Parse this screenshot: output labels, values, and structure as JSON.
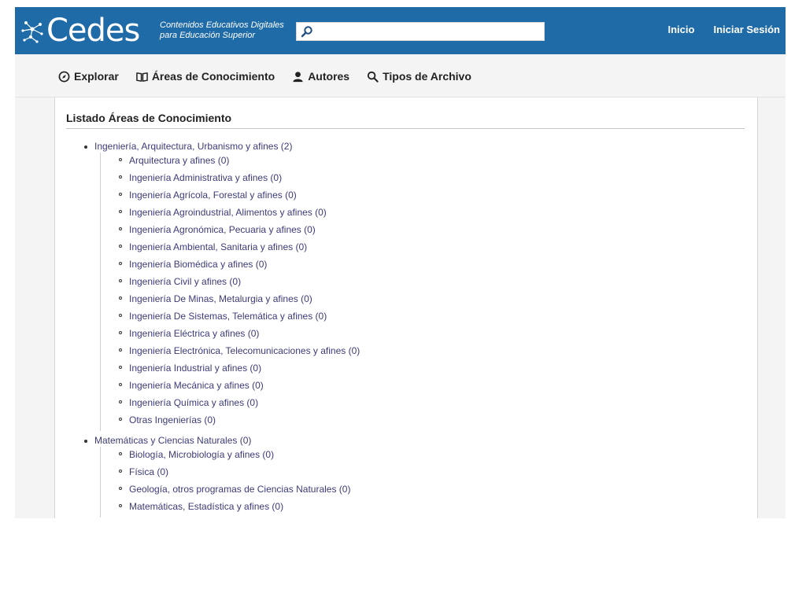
{
  "header": {
    "logo_text": "Cedes",
    "tagline_line1": "Contenidos Educativos Digitales",
    "tagline_line2": "para Educación Superior",
    "search": {
      "placeholder": "",
      "value": ""
    },
    "links": [
      "Inicio",
      "Iniciar Sesión"
    ],
    "colors": {
      "bar": "#1f6ba8"
    }
  },
  "nav": {
    "items": [
      {
        "label": "Explorar",
        "icon": "compass-icon"
      },
      {
        "label": "Áreas de Conocimiento",
        "icon": "book-icon"
      },
      {
        "label": "Autores",
        "icon": "user-icon"
      },
      {
        "label": "Tipos de Archivo",
        "icon": "search-icon"
      }
    ]
  },
  "content": {
    "title": "Listado Áreas de Conocimiento",
    "groups": [
      {
        "label": "Ingeniería, Arquitectura, Urbanismo y afines (2)",
        "items": [
          "Arquitectura y afines (0)",
          "Ingeniería Administrativa y afines (0)",
          "Ingeniería Agrícola, Forestal y afines (0)",
          "Ingeniería Agroindustrial, Alimentos y afines (0)",
          "Ingeniería Agronómica, Pecuaria y afines (0)",
          "Ingeniería Ambiental, Sanitaria y afines (0)",
          "Ingeniería Biomédica y afines (0)",
          "Ingeniería Civil y afines (0)",
          "Ingeniería De Minas, Metalurgia y afines (0)",
          "Ingeniería De Sistemas, Telemática y afines (0)",
          "Ingeniería Eléctrica y afines (0)",
          "Ingeniería Electrónica, Telecomunicaciones y afines (0)",
          "Ingeniería Industrial y afines (0)",
          "Ingeniería Mecánica y afines (0)",
          "Ingeniería Química y afines (0)",
          "Otras Ingenierías (0)"
        ]
      },
      {
        "label": "Matemáticas y Ciencias Naturales (0)",
        "items": [
          "Biología, Microbiología y afines (0)",
          "Física (0)",
          "Geología, otros programas de Ciencias Naturales (0)",
          "Matemáticas, Estadística y afines (0)"
        ]
      }
    ]
  }
}
